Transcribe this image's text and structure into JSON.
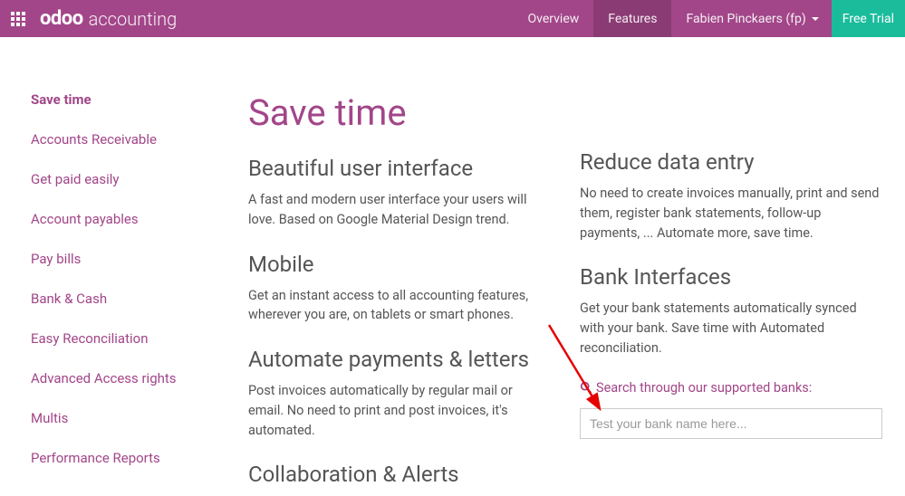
{
  "topbar": {
    "brand_logo": "odoo",
    "brand_sub": "accounting",
    "overview": "Overview",
    "features": "Features",
    "user": "Fabien Pinckaers (fp)",
    "trial": "Free Trial"
  },
  "sidebar": {
    "items": [
      "Save time",
      "Accounts Receivable",
      "Get paid easily",
      "Account payables",
      "Pay bills",
      "Bank & Cash",
      "Easy Reconciliation",
      "Advanced Access rights",
      "Multis",
      "Performance Reports"
    ]
  },
  "main": {
    "title": "Save time",
    "left": [
      {
        "heading": "Beautiful user interface",
        "body": "A fast and modern user interface your users will love. Based on Google Material Design trend."
      },
      {
        "heading": "Mobile",
        "body": "Get an instant access to all accounting features, wherever you are, on tablets or smart phones."
      },
      {
        "heading": "Automate payments & letters",
        "body": "Post invoices automatically by regular mail or email. No need to print and post invoices, it's automated."
      },
      {
        "heading": "Collaboration & Alerts",
        "body": ""
      }
    ],
    "right": [
      {
        "heading": "Reduce data entry",
        "body": "No need to create invoices manually, print and send them, register bank statements, follow-up payments, ... Automate more, save time."
      },
      {
        "heading": "Bank Interfaces",
        "body": "Get your bank statements automatically synced with your bank. Save time with Automated reconciliation."
      }
    ],
    "bank_search_label": "Search through our supported banks:",
    "bank_search_placeholder": "Test your bank name here..."
  }
}
